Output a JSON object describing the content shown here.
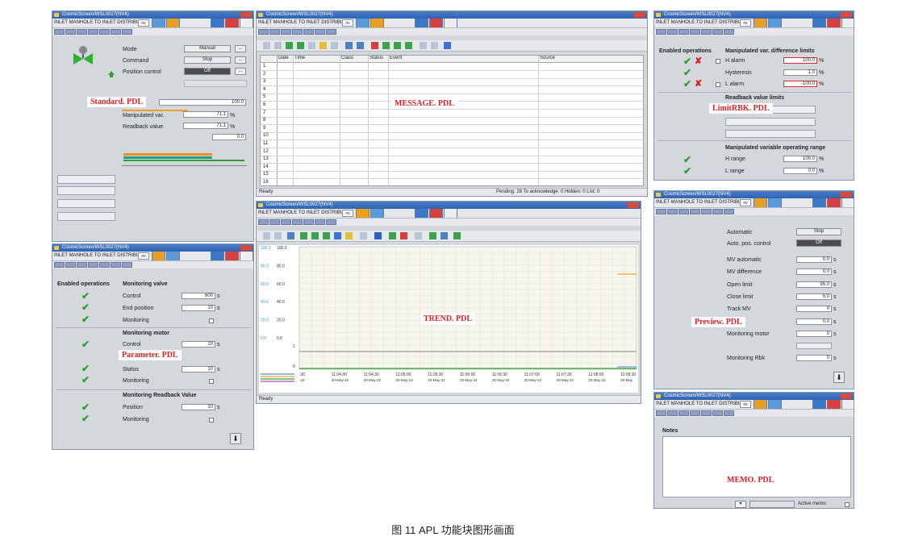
{
  "window": {
    "title": "CosmicScreen/WSL0027(NV4)",
    "instance": "INLET MANHOLE TO INLET DISTRIBUTION C",
    "dropdown": "nv"
  },
  "standard": {
    "annotation": "Standard. PDL",
    "rows": [
      {
        "label": "Mode",
        "value": "Manual"
      },
      {
        "label": "Command",
        "value": "Stop"
      },
      {
        "label": "Position control",
        "value": "Off"
      }
    ],
    "bar_value": "100.0",
    "manipulated_label": "Manipulated var.",
    "manipulated_value": "71.1",
    "readback_label": "Readback value",
    "readback_value": "71.1",
    "low_value": "0.0",
    "unit": "%"
  },
  "message": {
    "annotation": "MESSAGE. PDL",
    "columns": [
      "Date",
      "Time",
      "Class",
      "Status",
      "Event",
      "Source"
    ],
    "rows": [
      "1",
      "2",
      "3",
      "4",
      "5",
      "6",
      "7",
      "8",
      "9",
      "10",
      "11",
      "12",
      "13",
      "14",
      "15",
      "16"
    ],
    "status_ready": "Ready",
    "status_info": "Pending: 28   To acknowledge: 0   Hidden: 0   List: 0"
  },
  "limit": {
    "annotation": "LimitRBK. PDL",
    "header1": "Enabled operations",
    "header2": "Manipulated var. difference limits",
    "rows": [
      {
        "label": "H alarm",
        "value": "100.0"
      },
      {
        "label": "Hysteresis",
        "value": "1.0"
      },
      {
        "label": "L alarm",
        "value": "-100.0"
      }
    ],
    "readback_title": "Readback value limits",
    "range_title": "Manipulated variable operating range",
    "range_rows": [
      {
        "label": "H range",
        "value": "100.0"
      },
      {
        "label": "L range",
        "value": "0.0"
      }
    ],
    "unit": "%"
  },
  "parameter": {
    "annotation": "Parameter. PDL",
    "header1": "Enabled operations",
    "header2": "Monitoring valve",
    "valve_rows": [
      {
        "label": "Control",
        "value": "600"
      },
      {
        "label": "End position",
        "value": "10"
      },
      {
        "label": "Monitoring",
        "value": ""
      }
    ],
    "motor_title": "Monitoring motor",
    "motor_rows": [
      {
        "label": "Control",
        "value": "10"
      },
      {
        "label": "Status",
        "value": "10"
      },
      {
        "label": "Monitoring",
        "value": ""
      }
    ],
    "readback_title": "Monitoring Readback Value",
    "readback_rows": [
      {
        "label": "Position",
        "value": "10"
      },
      {
        "label": "Monitoring",
        "value": ""
      }
    ],
    "unit": "s"
  },
  "trend": {
    "annotation": "TREND. PDL",
    "status_ready": "Ready",
    "y_ticks_left": [
      "100.0",
      "80.0",
      "60.0",
      "40.0",
      "20.0",
      "0.0"
    ],
    "y_ticks_right": [
      "100.0",
      "80.0",
      "60.0",
      "40.0",
      "20.0",
      "0.0"
    ],
    "y_ticks_bin": [
      "1",
      "0"
    ],
    "x_ticks": [
      {
        "time": ":30",
        "date": "-22"
      },
      {
        "time": "11:04:00",
        "date": "20-May-22"
      },
      {
        "time": "11:04:30",
        "date": "20-May-22"
      },
      {
        "time": "11:05:00",
        "date": "20-May-22"
      },
      {
        "time": "11:05:30",
        "date": "20-May-22"
      },
      {
        "time": "11:06:00",
        "date": "20-May-22"
      },
      {
        "time": "11:06:30",
        "date": "20-May-22"
      },
      {
        "time": "11:07:00",
        "date": "20-May-22"
      },
      {
        "time": "11:07:30",
        "date": "20-May-22"
      },
      {
        "time": "11:08:00",
        "date": "20-May-22"
      },
      {
        "time": "11:08:30",
        "date": "20-May"
      }
    ],
    "colors": {
      "blue": "#4a90d9",
      "orange": "#f0a030",
      "green": "#30a030",
      "purple": "#a050c0"
    }
  },
  "preview": {
    "annotation": "Preview. PDL",
    "rows_top": [
      {
        "label": "Automatic",
        "value": "Stop"
      },
      {
        "label": "Auto. pos. control",
        "value": "Off"
      }
    ],
    "rows": [
      {
        "label": "MV automatic",
        "value": "0.0"
      },
      {
        "label": "MV difference",
        "value": "0.0"
      },
      {
        "label": "Open limit",
        "value": "95.0"
      },
      {
        "label": "Close limit",
        "value": "5.0"
      },
      {
        "label": "Track MV",
        "value": "0"
      },
      {
        "label": "",
        "value": "0.0"
      },
      {
        "label": "Monitoring motor",
        "value": "0"
      },
      {
        "label": "",
        "value": ""
      },
      {
        "label": "Monitoring Rbk",
        "value": "0"
      }
    ]
  },
  "memo": {
    "annotation": "MEMO. PDL",
    "notes_label": "Notes",
    "active_memo": "Active memo"
  },
  "caption": "图 11    APL 功能块图形画面"
}
